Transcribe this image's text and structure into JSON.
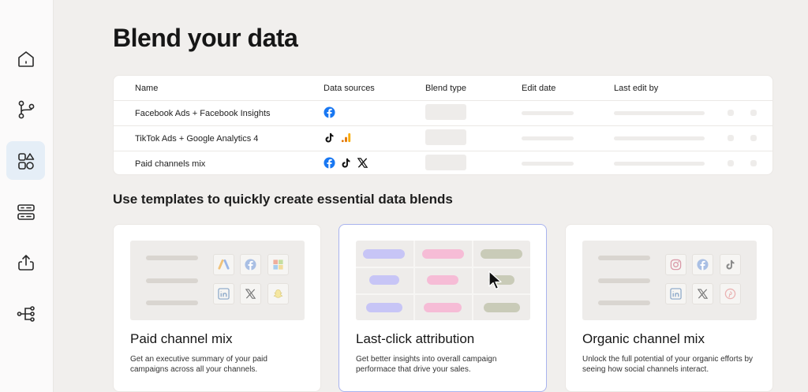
{
  "page_title": "Blend your data",
  "sidebar": {
    "items": [
      {
        "icon": "home-icon",
        "active": false
      },
      {
        "icon": "branch-icon",
        "active": false
      },
      {
        "icon": "shapes-icon",
        "active": true
      },
      {
        "icon": "server-icon",
        "active": false
      },
      {
        "icon": "upload-icon",
        "active": false
      },
      {
        "icon": "workflow-icon",
        "active": false
      }
    ]
  },
  "table": {
    "headers": {
      "name": "Name",
      "sources": "Data sources",
      "blend_type": "Blend type",
      "edit_date": "Edit date",
      "last_edit_by": "Last edit by"
    },
    "rows": [
      {
        "name": "Facebook Ads + Facebook Insights",
        "sources": [
          "facebook-icon"
        ]
      },
      {
        "name": "TikTok Ads + Google Analytics 4",
        "sources": [
          "tiktok-icon",
          "google-analytics-icon"
        ]
      },
      {
        "name": "Paid channels mix",
        "sources": [
          "facebook-icon",
          "tiktok-icon",
          "x-icon"
        ]
      }
    ]
  },
  "templates": {
    "section_title": "Use templates to quickly create essential data blends",
    "cards": [
      {
        "title": "Paid channel mix",
        "description": "Get an executive summary of your paid campaigns across all your channels.",
        "icons": [
          "google-ads-icon",
          "facebook-icon",
          "microsoft-icon",
          "linkedin-icon",
          "x-icon",
          "snapchat-icon"
        ]
      },
      {
        "title": "Last-click attribution",
        "description": "Get better insights into overall campaign performace that drive your sales.",
        "highlighted": true
      },
      {
        "title": "Organic channel mix",
        "description": "Unlock the full potential of your organic efforts by seeing how social channels interact.",
        "icons": [
          "instagram-icon",
          "facebook-icon",
          "tiktok-icon",
          "linkedin-icon",
          "x-icon",
          "pinterest-icon"
        ]
      }
    ]
  },
  "colors": {
    "facebook": "#1877f2",
    "ga_orange": "#f9ab00",
    "accent_border": "#a9b3ee",
    "pill_purple": "#c7c5f6",
    "pill_pink": "#f6bcd6",
    "pill_olive": "#c9cbb8"
  }
}
